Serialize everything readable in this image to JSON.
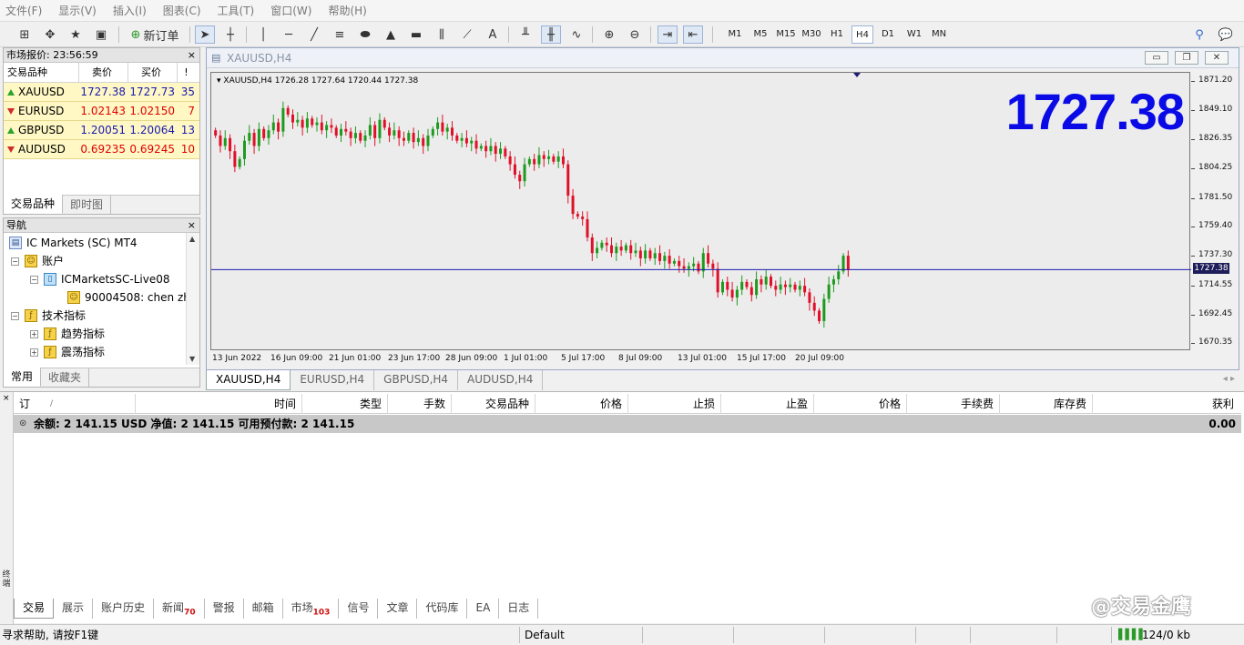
{
  "menu": [
    "文件(F)",
    "显示(V)",
    "插入(I)",
    "图表(C)",
    "工具(T)",
    "窗口(W)",
    "帮助(H)"
  ],
  "toolbar": {
    "new_order": "新订单",
    "text_tool": "A",
    "timeframes": [
      "M1",
      "M5",
      "M15",
      "M30",
      "H1",
      "H4",
      "D1",
      "W1",
      "MN"
    ],
    "active_timeframe": "H4"
  },
  "market_watch": {
    "title": "市场报价: 23:56:59",
    "close": "×",
    "headers": [
      "交易品种",
      "卖价",
      "买价",
      "!"
    ],
    "rows": [
      {
        "symbol": "XAUUSD",
        "bid": "1727.38",
        "ask": "1727.73",
        "spread": "35",
        "dir": "up"
      },
      {
        "symbol": "EURUSD",
        "bid": "1.02143",
        "ask": "1.02150",
        "spread": "7",
        "dir": "down"
      },
      {
        "symbol": "GBPUSD",
        "bid": "1.20051",
        "ask": "1.20064",
        "spread": "13",
        "dir": "up"
      },
      {
        "symbol": "AUDUSD",
        "bid": "0.69235",
        "ask": "0.69245",
        "spread": "10",
        "dir": "down"
      }
    ],
    "tabs": [
      "交易品种",
      "即时图"
    ]
  },
  "navigator": {
    "title": "导航",
    "close": "×",
    "items": [
      {
        "label": "IC Markets (SC) MT4",
        "level": 0
      },
      {
        "label": "账户",
        "level": 1
      },
      {
        "label": "ICMarketsSC-Live08",
        "level": 2
      },
      {
        "label": "90004508: chen zh",
        "level": 3
      },
      {
        "label": "技术指标",
        "level": 1
      },
      {
        "label": "趋势指标",
        "level": 2
      },
      {
        "label": "震荡指标",
        "level": 2
      }
    ],
    "tabs": [
      "常用",
      "收藏夹"
    ]
  },
  "chart_window": {
    "title": "XAUUSD,H4",
    "info": "XAUUSD,H4  1726.28 1727.64 1720.44 1727.38",
    "big_price": "1727.38",
    "current_price_label": "1727.38",
    "btn_min": "▭",
    "btn_max": "❐",
    "btn_close": "✕"
  },
  "chart_data": {
    "type": "candlestick",
    "symbol": "XAUUSD",
    "timeframe": "H4",
    "y_ticks": [
      "1871.20",
      "1849.10",
      "1826.35",
      "1804.25",
      "1781.50",
      "1759.40",
      "1737.30",
      "1714.55",
      "1692.45",
      "1670.35"
    ],
    "y_tick_values": [
      1871.2,
      1849.1,
      1826.35,
      1804.25,
      1781.5,
      1759.4,
      1737.3,
      1714.55,
      1692.45,
      1670.35
    ],
    "ylim": [
      1665,
      1878
    ],
    "x_ticks": [
      "13 Jun 2022",
      "16 Jun 09:00",
      "21 Jun 01:00",
      "23 Jun 17:00",
      "28 Jun 09:00",
      "1 Jul 01:00",
      "5 Jul 17:00",
      "8 Jul 09:00",
      "13 Jul 01:00",
      "15 Jul 17:00",
      "20 Jul 09:00"
    ],
    "bid_line": 1727.38,
    "bull_color": "#1e9a1e",
    "bear_color": "#e0102a",
    "closes": [
      1830,
      1822,
      1828,
      1818,
      1806,
      1812,
      1826,
      1832,
      1822,
      1835,
      1828,
      1834,
      1840,
      1833,
      1851,
      1846,
      1840,
      1842,
      1836,
      1843,
      1838,
      1840,
      1834,
      1838,
      1836,
      1830,
      1835,
      1833,
      1828,
      1832,
      1826,
      1830,
      1838,
      1828,
      1842,
      1836,
      1830,
      1834,
      1828,
      1826,
      1832,
      1825,
      1828,
      1822,
      1830,
      1835,
      1840,
      1833,
      1836,
      1830,
      1826,
      1828,
      1824,
      1826,
      1820,
      1822,
      1818,
      1822,
      1816,
      1820,
      1814,
      1808,
      1800,
      1795,
      1808,
      1812,
      1808,
      1815,
      1812,
      1814,
      1810,
      1814,
      1808,
      1784,
      1770,
      1768,
      1766,
      1752,
      1740,
      1744,
      1748,
      1746,
      1740,
      1745,
      1742,
      1746,
      1740,
      1742,
      1736,
      1742,
      1736,
      1740,
      1734,
      1738,
      1732,
      1734,
      1730,
      1728,
      1730,
      1732,
      1726,
      1740,
      1732,
      1728,
      1710,
      1718,
      1712,
      1706,
      1712,
      1718,
      1714,
      1708,
      1720,
      1716,
      1722,
      1715,
      1712,
      1716,
      1714,
      1716,
      1712,
      1715,
      1710,
      1702,
      1696,
      1688,
      1705,
      1716,
      1720,
      1726,
      1738,
      1727
    ]
  },
  "chart_tabs": [
    "XAUUSD,H4",
    "EURUSD,H4",
    "GBPUSD,H4",
    "AUDUSD,H4"
  ],
  "terminal": {
    "headers": [
      "订单",
      "/",
      "时间",
      "类型",
      "手数",
      "交易品种",
      "价格",
      "止损",
      "止盈",
      "价格",
      "手续费",
      "库存费",
      "获利"
    ],
    "balance_text": "余额: 2 141.15 USD  净值: 2 141.15  可用预付款: 2 141.15",
    "balance_profit": "0.00",
    "side_label": "终端",
    "tabs": [
      {
        "label": "交易",
        "badge": ""
      },
      {
        "label": "展示",
        "badge": ""
      },
      {
        "label": "账户历史",
        "badge": ""
      },
      {
        "label": "新闻",
        "badge": "70"
      },
      {
        "label": "警报",
        "badge": ""
      },
      {
        "label": "邮箱",
        "badge": ""
      },
      {
        "label": "市场",
        "badge": "103"
      },
      {
        "label": "信号",
        "badge": ""
      },
      {
        "label": "文章",
        "badge": ""
      },
      {
        "label": "代码库",
        "badge": ""
      },
      {
        "label": "EA",
        "badge": ""
      },
      {
        "label": "日志",
        "badge": ""
      }
    ]
  },
  "status": {
    "help": "寻求帮助, 请按F1键",
    "profile": "Default",
    "traffic": "124/0 kb"
  },
  "watermark": "@交易金鹰"
}
